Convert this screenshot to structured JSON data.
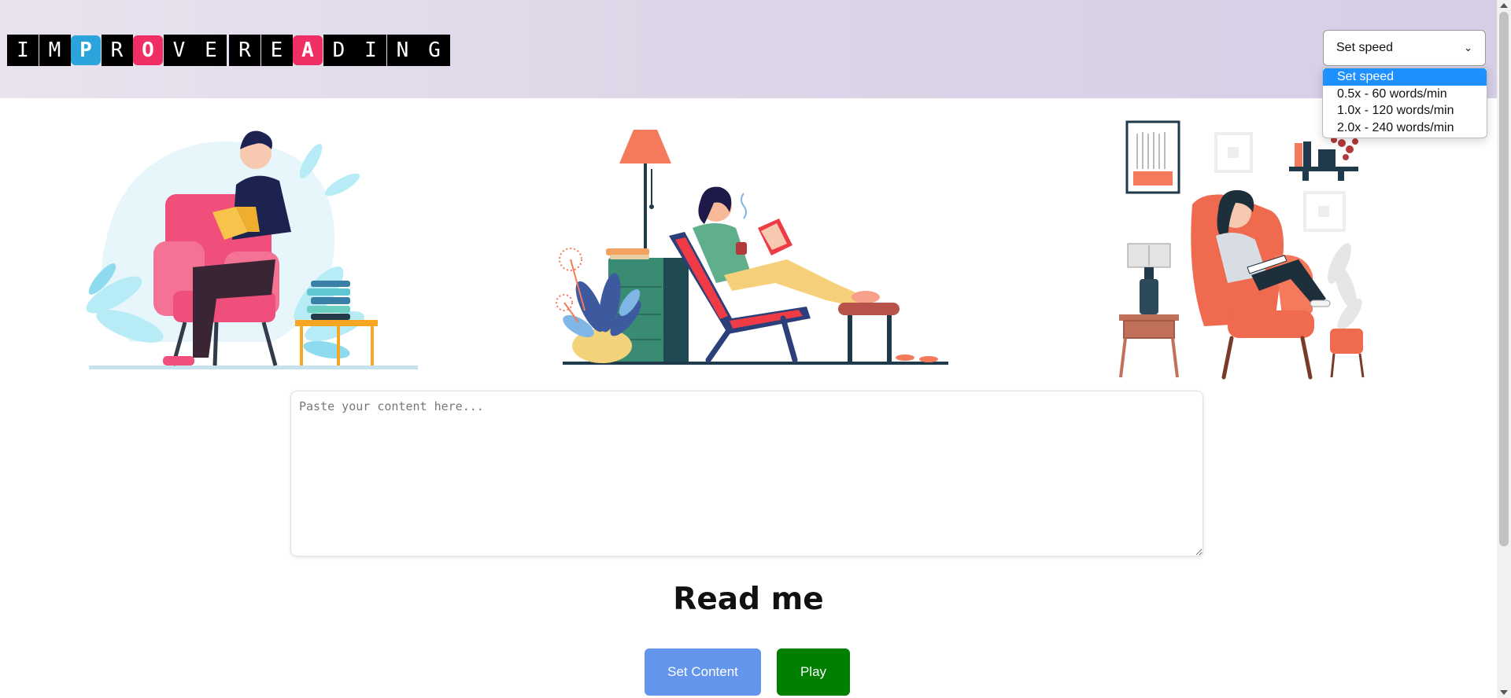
{
  "logo": {
    "letters": [
      "I",
      "M",
      "P",
      "R",
      "O",
      "V",
      "E",
      "R",
      "E",
      "A",
      "D",
      "I",
      "N",
      "G"
    ]
  },
  "speed": {
    "selected": "Set speed",
    "options": [
      "Set speed",
      "0.5x - 60 words/min",
      "1.0x - 120 words/min",
      "2.0x - 240 words/min"
    ]
  },
  "editor": {
    "placeholder": "Paste your content here...",
    "value": ""
  },
  "reader": {
    "title": "Read me"
  },
  "buttons": {
    "set_content": "Set Content",
    "play": "Play"
  },
  "colors": {
    "header_bg": "#ddd6e8",
    "accent_blue": "#2ba4dc",
    "accent_pink": "#ef2e63",
    "set_content_bg": "#6495ed",
    "play_bg": "#008000",
    "option_highlight": "#1e90ff"
  }
}
